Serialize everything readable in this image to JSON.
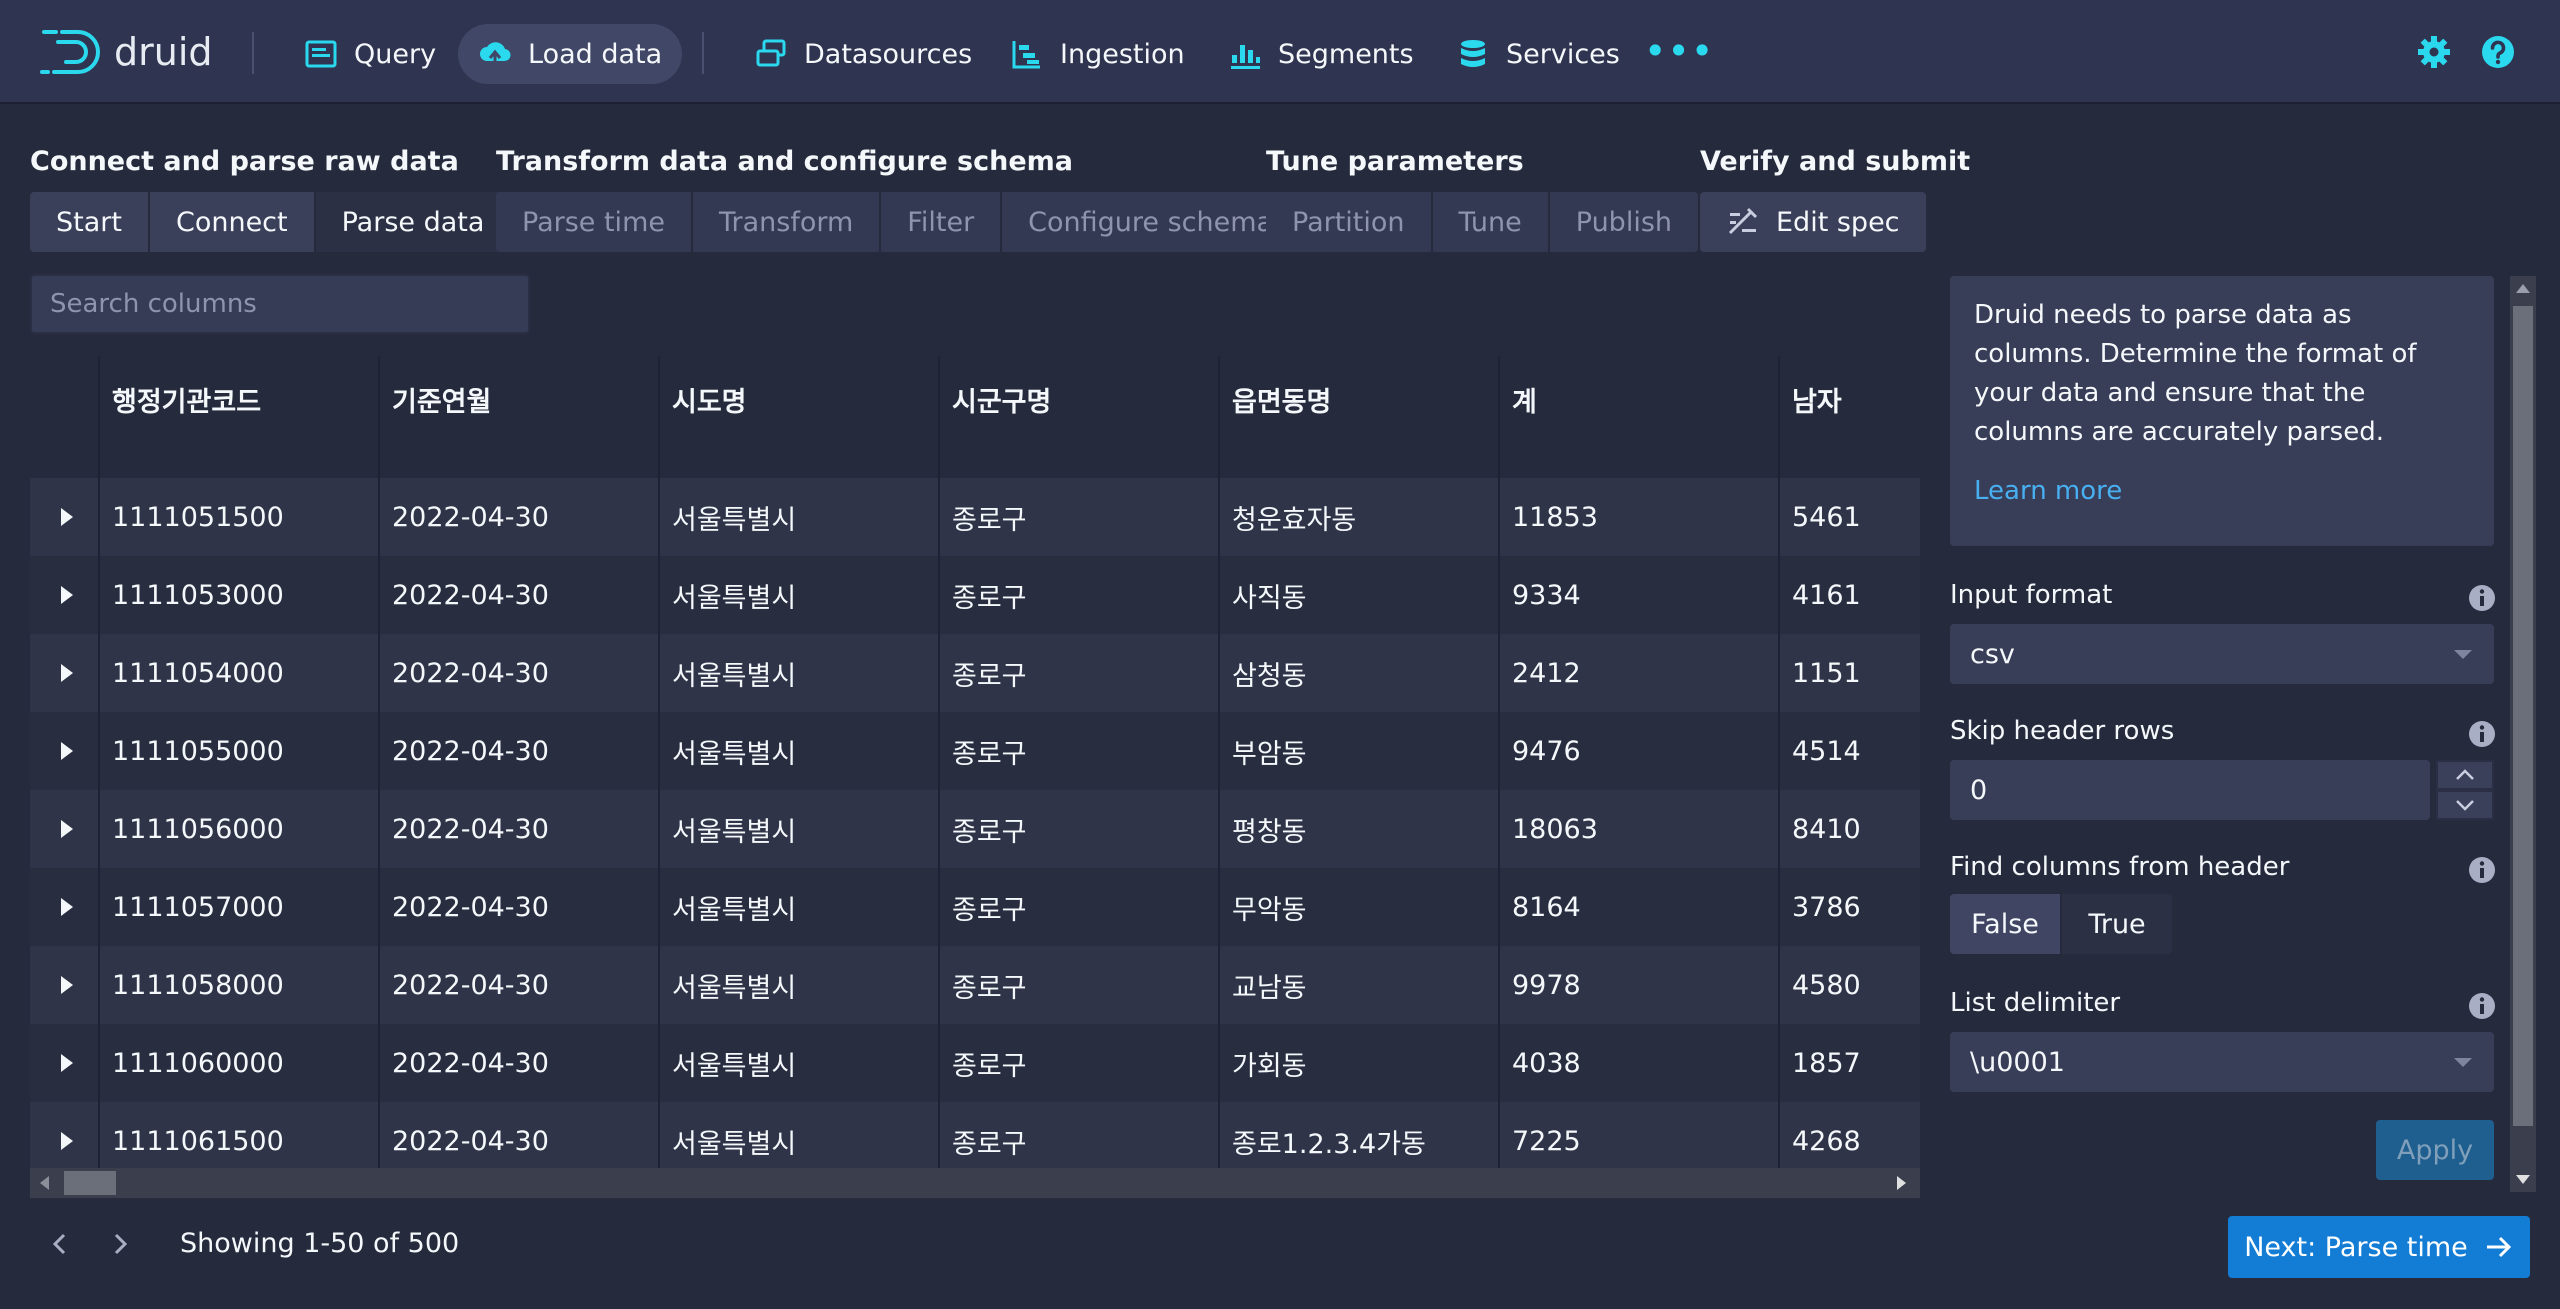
{
  "app": {
    "logo_text": "druid"
  },
  "nav": {
    "items": [
      {
        "label": "Query",
        "icon": "query-icon"
      },
      {
        "label": "Load data",
        "icon": "upload-icon",
        "active": true
      },
      {
        "label": "Datasources",
        "icon": "datasources-icon"
      },
      {
        "label": "Ingestion",
        "icon": "ingestion-icon"
      },
      {
        "label": "Segments",
        "icon": "segments-icon"
      },
      {
        "label": "Services",
        "icon": "database-icon"
      }
    ],
    "more": "•••",
    "accent_color": "#2ad9ee"
  },
  "steps": {
    "groups": [
      {
        "title": "Connect and parse raw data",
        "buttons": [
          "Start",
          "Connect",
          "Parse data"
        ]
      },
      {
        "title": "Transform data and configure schema",
        "buttons": [
          "Parse time",
          "Transform",
          "Filter",
          "Configure schema"
        ]
      },
      {
        "title": "Tune parameters",
        "buttons": [
          "Partition",
          "Tune",
          "Publish"
        ]
      },
      {
        "title": "Verify and submit",
        "buttons": [
          "Edit spec"
        ]
      }
    ],
    "current": "Parse data"
  },
  "search": {
    "placeholder": "Search columns"
  },
  "table": {
    "columns": [
      "",
      "행정기관코드",
      "기준연월",
      "시도명",
      "시군구명",
      "읍면동명",
      "계",
      "남자"
    ],
    "rows": [
      [
        "1111051500",
        "2022-04-30",
        "서울특별시",
        "종로구",
        "청운효자동",
        "11853",
        "5461"
      ],
      [
        "1111053000",
        "2022-04-30",
        "서울특별시",
        "종로구",
        "사직동",
        "9334",
        "4161"
      ],
      [
        "1111054000",
        "2022-04-30",
        "서울특별시",
        "종로구",
        "삼청동",
        "2412",
        "1151"
      ],
      [
        "1111055000",
        "2022-04-30",
        "서울특별시",
        "종로구",
        "부암동",
        "9476",
        "4514"
      ],
      [
        "1111056000",
        "2022-04-30",
        "서울특별시",
        "종로구",
        "평창동",
        "18063",
        "8410"
      ],
      [
        "1111057000",
        "2022-04-30",
        "서울특별시",
        "종로구",
        "무악동",
        "8164",
        "3786"
      ],
      [
        "1111058000",
        "2022-04-30",
        "서울특별시",
        "종로구",
        "교남동",
        "9978",
        "4580"
      ],
      [
        "1111060000",
        "2022-04-30",
        "서울특별시",
        "종로구",
        "가회동",
        "4038",
        "1857"
      ],
      [
        "1111061500",
        "2022-04-30",
        "서울특별시",
        "종로구",
        "종로1.2.3.4가동",
        "7225",
        "4268"
      ]
    ]
  },
  "pager": {
    "text": "Showing 1-50 of 500"
  },
  "panel": {
    "callout_text": "Druid needs to parse data as columns. Determine the format of your data and ensure that the columns are accurately parsed.",
    "learn_more": "Learn more",
    "input_format_label": "Input format",
    "input_format_value": "csv",
    "skip_header_label": "Skip header rows",
    "skip_header_value": "0",
    "find_columns_label": "Find columns from header",
    "find_columns_options": [
      "False",
      "True"
    ],
    "find_columns_selected": "False",
    "list_delimiter_label": "List delimiter",
    "list_delimiter_value": "\\u0001",
    "apply_label": "Apply"
  },
  "footer": {
    "next_label": "Next: Parse time",
    "next_color": "#137cd5"
  }
}
